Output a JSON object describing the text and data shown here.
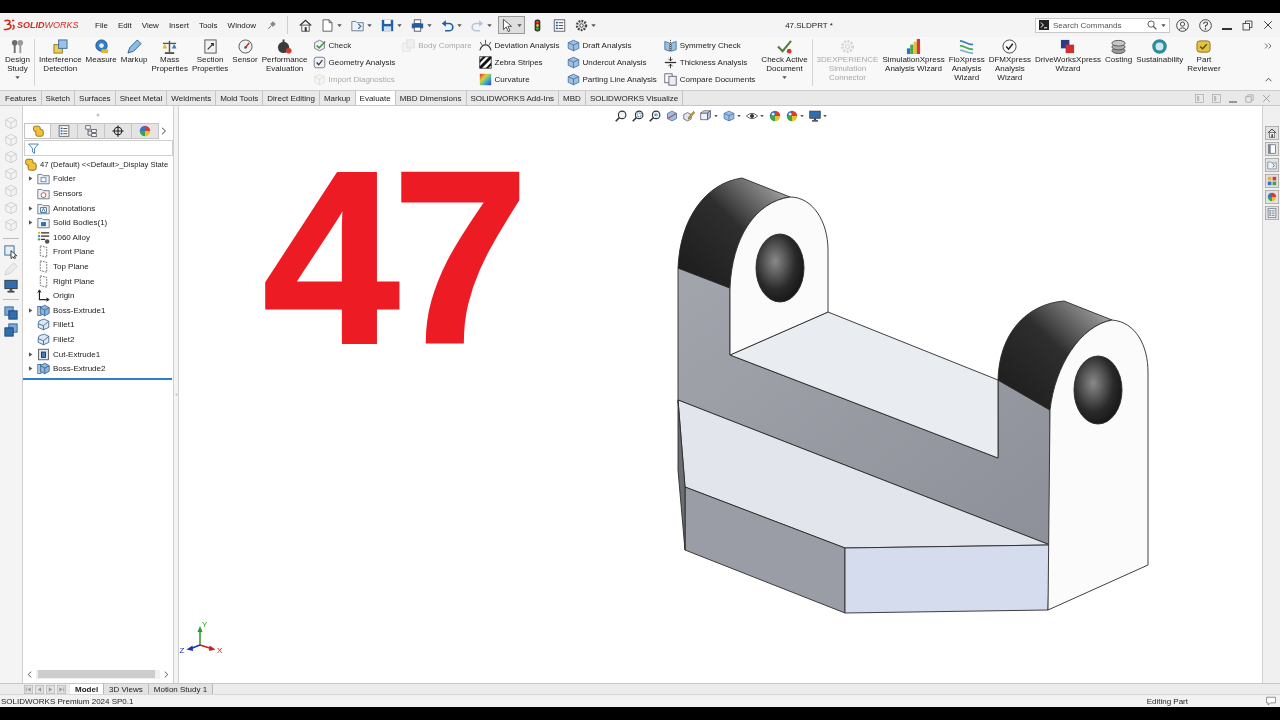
{
  "app": {
    "logo": "**SOLID**WORKS"
  },
  "menu": [
    "File",
    "Edit",
    "View",
    "Insert",
    "Tools",
    "Window"
  ],
  "quick_access": [
    {
      "dropdown": false,
      "disabled": false,
      "pressed": false
    },
    {
      "dropdown": true,
      "disabled": false,
      "pressed": false
    },
    {
      "dropdown": true,
      "disabled": false,
      "pressed": false
    },
    {
      "dropdown": true,
      "disabled": false,
      "pressed": false
    },
    {
      "dropdown": true,
      "disabled": false,
      "pressed": false
    },
    {
      "dropdown": true,
      "disabled": false,
      "pressed": false
    },
    {
      "dropdown": true,
      "disabled": true,
      "pressed": false
    },
    {
      "dropdown": true,
      "disabled": false,
      "pressed": true
    },
    {
      "dropdown": false,
      "disabled": false,
      "pressed": false
    },
    {
      "dropdown": false,
      "disabled": false,
      "pressed": false
    },
    {
      "dropdown": true,
      "disabled": false,
      "pressed": false
    }
  ],
  "document_title": "47.SLDPRT *",
  "search": {
    "placeholder": "Search Commands"
  },
  "ribbon": {
    "groups": [
      {
        "items": [
          {
            "kind": "large",
            "label": "Design\nStudy",
            "dropdown": true,
            "disabled": false
          }
        ]
      },
      {
        "items": [
          {
            "kind": "large",
            "label": "Interference\nDetection",
            "dropdown": false,
            "disabled": false
          },
          {
            "kind": "large",
            "label": "Measure",
            "dropdown": false,
            "disabled": false
          },
          {
            "kind": "large",
            "label": "Markup",
            "dropdown": false,
            "disabled": false
          },
          {
            "kind": "large",
            "label": "Mass\nProperties",
            "dropdown": false,
            "disabled": false
          },
          {
            "kind": "large",
            "label": "Section\nProperties",
            "dropdown": false,
            "disabled": false
          },
          {
            "kind": "large",
            "label": "Sensor",
            "dropdown": false,
            "disabled": false
          },
          {
            "kind": "large",
            "label": "Performance\nEvaluation",
            "dropdown": false,
            "disabled": false
          },
          {
            "kind": "column",
            "entries": [
              {
                "label": "Check",
                "disabled": false
              },
              {
                "label": "Geometry Analysis",
                "disabled": false
              },
              {
                "label": "Import Diagnostics",
                "disabled": true
              }
            ]
          },
          {
            "kind": "column",
            "entries": [
              {
                "label": "Body Compare",
                "disabled": true
              }
            ]
          },
          {
            "kind": "column",
            "entries": [
              {
                "label": "Deviation Analysis",
                "disabled": false
              },
              {
                "label": "Zebra Stripes",
                "disabled": false
              },
              {
                "label": "Curvature",
                "disabled": false
              }
            ]
          },
          {
            "kind": "column",
            "entries": [
              {
                "label": "Draft Analysis",
                "disabled": false
              },
              {
                "label": "Undercut Analysis",
                "disabled": false
              },
              {
                "label": "Parting Line Analysis",
                "disabled": false
              }
            ]
          },
          {
            "kind": "column",
            "entries": [
              {
                "label": "Symmetry Check",
                "disabled": false
              },
              {
                "label": "Thickness Analysis",
                "disabled": false
              },
              {
                "label": "Compare Documents",
                "disabled": false
              }
            ]
          },
          {
            "kind": "large",
            "label": "Check Active\nDocument",
            "dropdown": true,
            "disabled": false
          }
        ]
      },
      {
        "items": [
          {
            "kind": "large",
            "label": "3DEXPERIENCE\nSimulation\nConnector",
            "dropdown": false,
            "disabled": true
          },
          {
            "kind": "large",
            "label": "SimulationXpress\nAnalysis Wizard",
            "dropdown": false,
            "disabled": false
          },
          {
            "kind": "large",
            "label": "FloXpress\nAnalysis\nWizard",
            "dropdown": false,
            "disabled": false
          },
          {
            "kind": "large",
            "label": "DFMXpress\nAnalysis\nWizard",
            "dropdown": false,
            "disabled": false
          },
          {
            "kind": "large",
            "label": "DriveWorksXpress\nWizard",
            "dropdown": false,
            "disabled": false
          },
          {
            "kind": "large",
            "label": "Costing",
            "dropdown": false,
            "disabled": false
          },
          {
            "kind": "large",
            "label": "Sustainability",
            "dropdown": false,
            "disabled": false
          },
          {
            "kind": "large",
            "label": "Part\nReviewer",
            "dropdown": false,
            "disabled": false
          }
        ]
      }
    ]
  },
  "tabs": [
    {
      "label": "Features",
      "selected": false
    },
    {
      "label": "Sketch",
      "selected": false
    },
    {
      "label": "Surfaces",
      "selected": false
    },
    {
      "label": "Sheet Metal",
      "selected": false
    },
    {
      "label": "Weldments",
      "selected": false
    },
    {
      "label": "Mold Tools",
      "selected": false
    },
    {
      "label": "Direct Editing",
      "selected": false
    },
    {
      "label": "Markup",
      "selected": false
    },
    {
      "label": "Evaluate",
      "selected": true
    },
    {
      "label": "MBD Dimensions",
      "selected": false
    },
    {
      "label": "SOLIDWORKS Add-Ins",
      "selected": false
    },
    {
      "label": "MBD",
      "selected": false
    },
    {
      "label": "SOLIDWORKS Visualize",
      "selected": false
    }
  ],
  "left_toolbar": {
    "groups": [
      [
        {
          "disabled": true
        },
        {
          "disabled": true
        },
        {
          "disabled": true
        },
        {
          "disabled": true
        },
        {
          "disabled": true
        },
        {
          "disabled": true
        },
        {
          "disabled": true
        }
      ],
      [
        {
          "disabled": false
        },
        {
          "disabled": true
        },
        {
          "disabled": false
        }
      ],
      [
        {
          "disabled": false
        },
        {
          "disabled": false
        }
      ]
    ]
  },
  "feature_manager": {
    "tabs": [
      {
        "selected": true
      },
      {
        "selected": false
      },
      {
        "selected": false
      },
      {
        "selected": false
      },
      {
        "selected": false
      }
    ],
    "root": "47 (Default) <<Default>_Display State",
    "items": [
      {
        "label": "Folder",
        "kind": "folder",
        "expandable": true
      },
      {
        "label": "Sensors",
        "kind": "sensors",
        "expandable": false
      },
      {
        "label": "Annotations",
        "kind": "annotations",
        "expandable": true
      },
      {
        "label": "Solid Bodies(1)",
        "kind": "bodies",
        "expandable": true
      },
      {
        "label": "1060 Alloy",
        "kind": "material",
        "expandable": false
      },
      {
        "label": "Front Plane",
        "kind": "plane",
        "expandable": false
      },
      {
        "label": "Top Plane",
        "kind": "plane",
        "expandable": false
      },
      {
        "label": "Right Plane",
        "kind": "plane",
        "expandable": false
      },
      {
        "label": "Origin",
        "kind": "origin",
        "expandable": false
      },
      {
        "label": "Boss-Extrude1",
        "kind": "feature",
        "expandable": true
      },
      {
        "label": "Fillet1",
        "kind": "fillet",
        "expandable": false
      },
      {
        "label": "Fillet2",
        "kind": "fillet",
        "expandable": false
      },
      {
        "label": "Cut-Extrude1",
        "kind": "cut",
        "expandable": true
      },
      {
        "label": "Boss-Extrude2",
        "kind": "feature",
        "expandable": true
      }
    ]
  },
  "viewport": {
    "overlay_text": "47",
    "triad": {
      "x": "X",
      "y": "Y",
      "z": "Z"
    }
  },
  "bottom_tabs": [
    {
      "label": "Model",
      "selected": true
    },
    {
      "label": "3D Views",
      "selected": false
    },
    {
      "label": "Motion Study 1",
      "selected": false
    }
  ],
  "status_bar": {
    "product": "SOLIDWORKS Premium 2024 SP0.1",
    "mode": "Editing Part"
  }
}
